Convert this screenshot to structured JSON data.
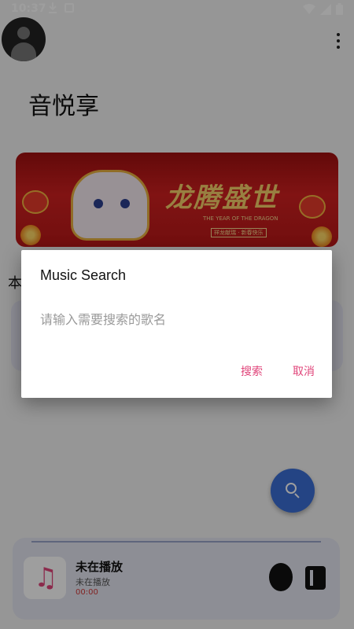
{
  "status_bar": {
    "time": "10:37",
    "icons": [
      "download-icon",
      "image-icon",
      "wifi-icon",
      "signal-icon",
      "battery-icon"
    ]
  },
  "header": {
    "title": "音悦享",
    "avatar_icon": "person-icon",
    "menu_icon": "more-vert-icon"
  },
  "banner": {
    "headline": "龙腾盛世",
    "subtitle": "THE YEAR OF THE DRAGON",
    "tag": "祥龙献瑞 · 新春快乐"
  },
  "section": {
    "label": "本"
  },
  "fab": {
    "icon": "search-icon"
  },
  "player": {
    "song_title": "未在播放",
    "artist": "未在播放",
    "time": "00:00",
    "icons": [
      "music-note-icon",
      "play-icon",
      "playlist-icon"
    ]
  },
  "dialog": {
    "title": "Music Search",
    "input_placeholder": "请输入需要搜索的歌名",
    "input_value": "",
    "confirm_label": "搜索",
    "cancel_label": "取消"
  },
  "colors": {
    "accent": "#e0457a",
    "fab": "#3b6fd6",
    "scrim": "rgba(0,0,0,0.38)"
  }
}
